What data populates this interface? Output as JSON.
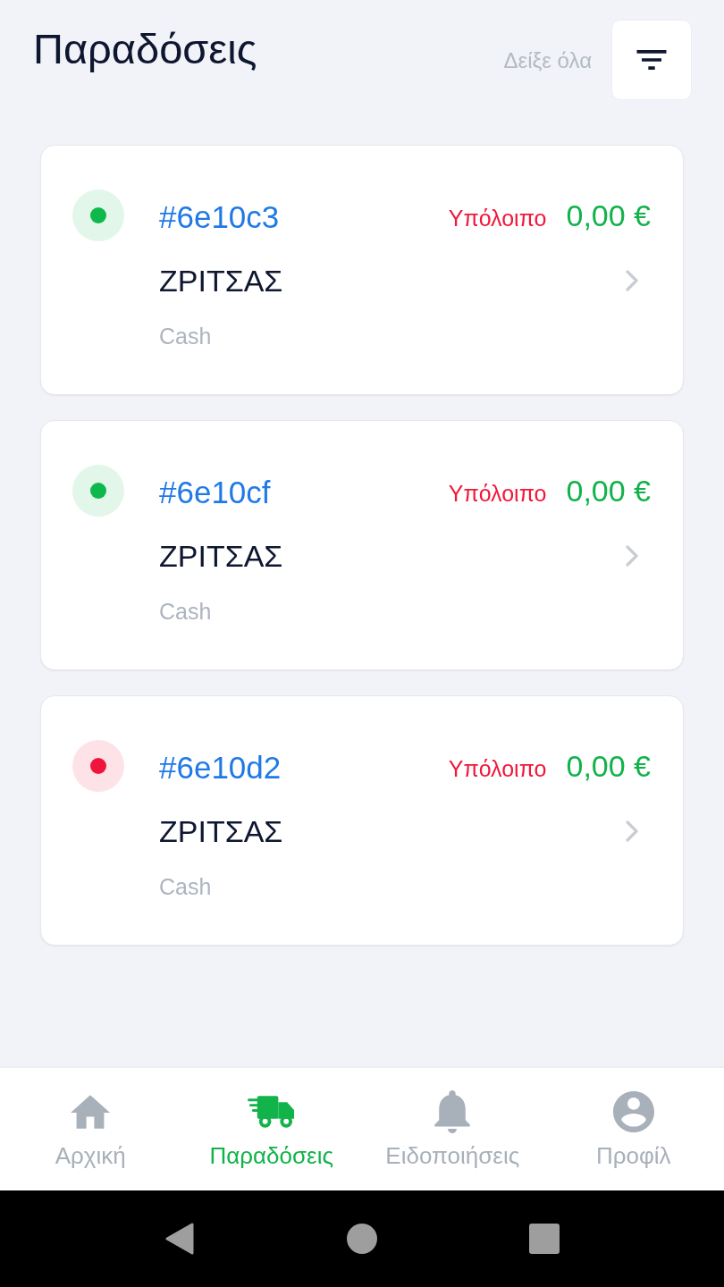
{
  "header": {
    "title": "Παραδόσεις",
    "show_all": "Δείξε όλα"
  },
  "deliveries": [
    {
      "order_id": "#6e10c3",
      "color": "#0fb84c",
      "customer": "ΖΡΙΤΣΑΣ",
      "payment": "Cash",
      "balance_label": "Υπόλοιπο",
      "balance": "0,00 €"
    },
    {
      "order_id": "#6e10cf",
      "color": "#0fb84c",
      "customer": "ΖΡΙΤΣΑΣ",
      "payment": "Cash",
      "balance_label": "Υπόλοιπο",
      "balance": "0,00 €"
    },
    {
      "order_id": "#6e10d2",
      "color": "#f0163b",
      "customer": "ΖΡΙΤΣΑΣ",
      "payment": "Cash",
      "balance_label": "Υπόλοιπο",
      "balance": "0,00 €"
    }
  ],
  "bottom_nav": [
    {
      "label": "Αρχική",
      "selected": false
    },
    {
      "label": "Παραδόσεις",
      "selected": true
    },
    {
      "label": "Ειδοποιήσεις",
      "selected": false
    },
    {
      "label": "Προφίλ",
      "selected": false
    }
  ]
}
